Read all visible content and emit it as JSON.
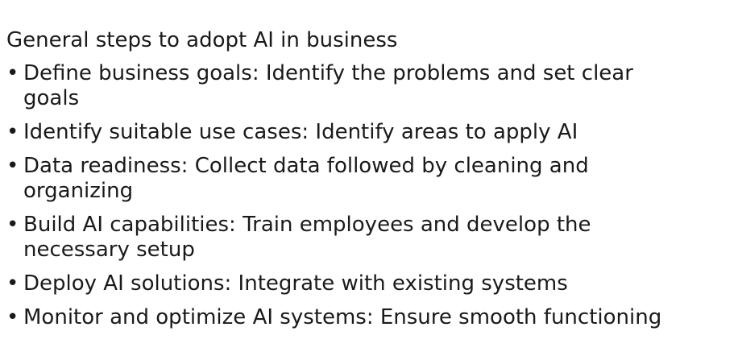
{
  "heading": "General steps to adopt AI in business",
  "bullet_glyph": "•",
  "steps": [
    {
      "text": "Define business goals: Identify the problems and set clear goals"
    },
    {
      "text": "Identify suitable use cases: Identify areas to apply AI"
    },
    {
      "text": "Data readiness: Collect data followed by cleaning and organizing"
    },
    {
      "text": "Build AI capabilities: Train employees and develop the necessary setup"
    },
    {
      "text": "Deploy AI solutions: Integrate with existing systems"
    },
    {
      "text": "Monitor and optimize AI systems: Ensure smooth functioning"
    }
  ]
}
